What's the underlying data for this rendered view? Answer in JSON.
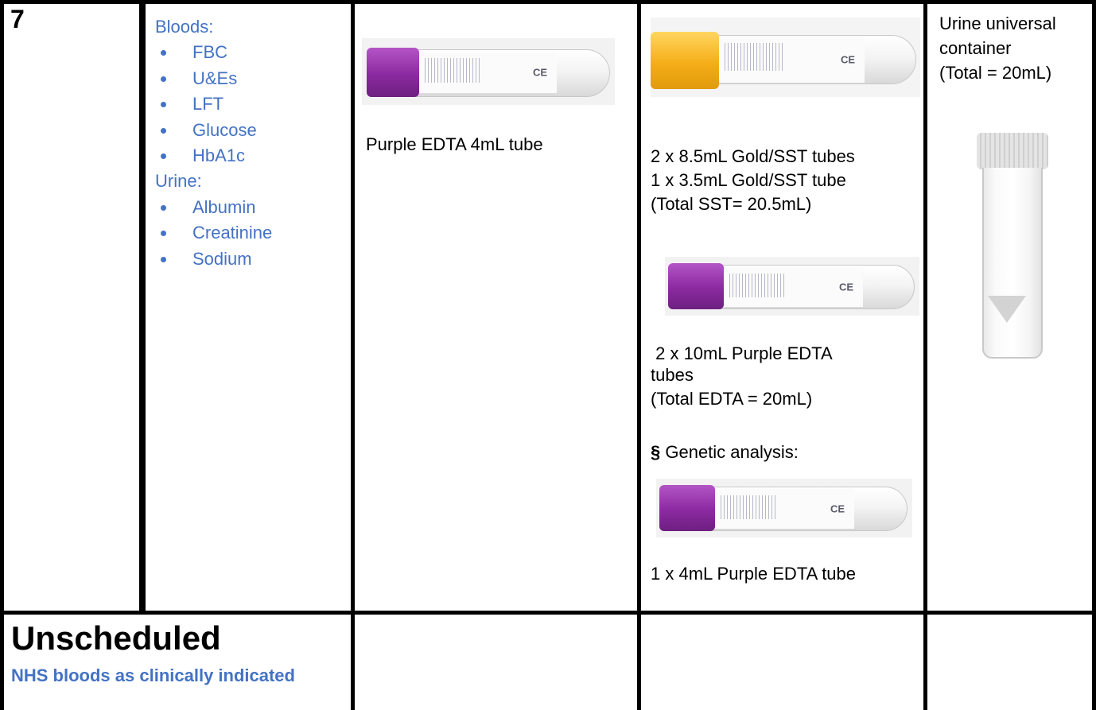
{
  "table": {
    "row1": {
      "visit_number": "7",
      "tests": {
        "bloods_header": "Bloods:",
        "bloods": [
          "FBC",
          "U&Es",
          "LFT",
          "Glucose",
          "HbA1c"
        ],
        "urine_header": "Urine:",
        "urine": [
          "Albumin",
          "Creatinine",
          "Sodium"
        ]
      },
      "col3": {
        "caption": "Purple EDTA 4mL tube",
        "tube_icon": "purple-edta-tube-image"
      },
      "col4": {
        "sst_lines": [
          "2 x 8.5mL Gold/SST tubes",
          "1 x 3.5mL  Gold/SST tube",
          "(Total SST= 20.5mL)"
        ],
        "edta_lines": [
          " 2 x 10mL Purple EDTA",
          "tubes",
          "(Total EDTA = 20mL)"
        ],
        "genetic_symbol": "§",
        "genetic_label": " Genetic analysis:",
        "genetic_caption": "1 x 4mL Purple EDTA tube",
        "gold_tube_icon": "gold-sst-tube-image",
        "purple_tube_icon": "purple-edta-tube-image"
      },
      "col5": {
        "lines": [
          "Urine universal",
          "container",
          "(Total = 20mL)"
        ],
        "container_icon": "urine-universal-container-image"
      }
    },
    "row2": {
      "title": "Unscheduled",
      "subtitle": "NHS bloods as clinically indicated"
    }
  },
  "colors": {
    "accent_blue": "#4472c4",
    "purple_cap": "#8b2aa0",
    "gold_cap": "#f5ae18"
  }
}
